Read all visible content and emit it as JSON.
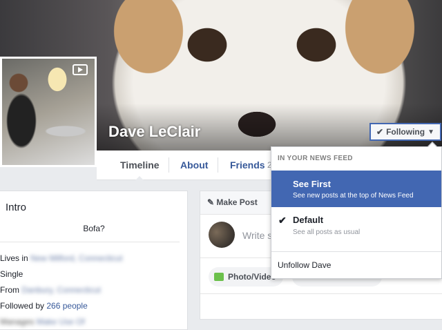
{
  "profile": {
    "name": "Dave LeClair",
    "follow_button": "Following"
  },
  "nav": {
    "tabs": [
      "Timeline",
      "About",
      "Friends",
      "2"
    ]
  },
  "intro": {
    "title": "Intro",
    "bio": "Bofa?",
    "lives_in_label": "Lives in",
    "lives_in_value": "New Milford, Connecticut",
    "relationship": "Single",
    "from_label": "From",
    "from_value": "Danbury, Connecticut",
    "followed_by_label": "Followed by",
    "followed_by_count": "266 people",
    "extra_label": "Manages",
    "extra_value": "Make Use Of"
  },
  "composer": {
    "make_post": "Make Post",
    "placeholder": "Write s",
    "photo_video": "Photo/Video"
  },
  "dropdown": {
    "header": "IN YOUR NEWS FEED",
    "options": [
      {
        "title": "See First",
        "subtitle": "See new posts at the top of News Feed"
      },
      {
        "title": "Default",
        "subtitle": "See all posts as usual"
      }
    ],
    "unfollow": "Unfollow Dave"
  },
  "colors": {
    "accent": "#4267b2",
    "link": "#365899",
    "background": "#e9ebee"
  },
  "icons": [
    "video-icon",
    "checkmark-icon",
    "caret-down-icon",
    "pencil-icon",
    "photo-icon"
  ]
}
